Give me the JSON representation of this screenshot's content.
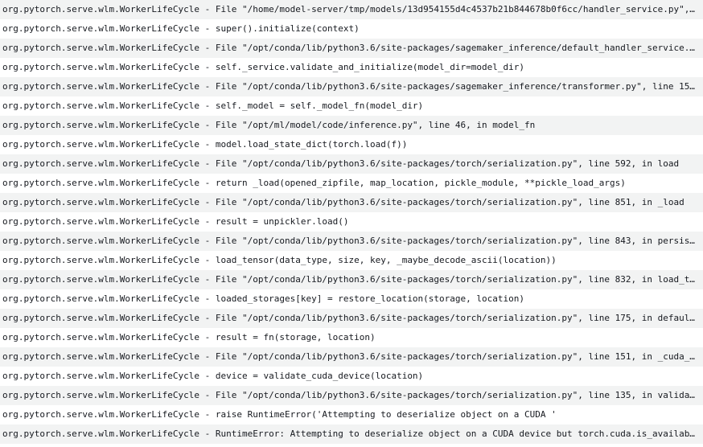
{
  "log": {
    "rows": [
      "org.pytorch.serve.wlm.WorkerLifeCycle - File \"/home/model-server/tmp/models/13d954155d4c4537b21b844678b0f6cc/handler_service.py\",…",
      "org.pytorch.serve.wlm.WorkerLifeCycle - super().initialize(context)",
      "org.pytorch.serve.wlm.WorkerLifeCycle - File \"/opt/conda/lib/python3.6/site-packages/sagemaker_inference/default_handler_service.…",
      "org.pytorch.serve.wlm.WorkerLifeCycle - self._service.validate_and_initialize(model_dir=model_dir)",
      "org.pytorch.serve.wlm.WorkerLifeCycle - File \"/opt/conda/lib/python3.6/site-packages/sagemaker_inference/transformer.py\", line 15…",
      "org.pytorch.serve.wlm.WorkerLifeCycle - self._model = self._model_fn(model_dir)",
      "org.pytorch.serve.wlm.WorkerLifeCycle - File \"/opt/ml/model/code/inference.py\", line 46, in model_fn",
      "org.pytorch.serve.wlm.WorkerLifeCycle - model.load_state_dict(torch.load(f))",
      "org.pytorch.serve.wlm.WorkerLifeCycle - File \"/opt/conda/lib/python3.6/site-packages/torch/serialization.py\", line 592, in load",
      "org.pytorch.serve.wlm.WorkerLifeCycle - return _load(opened_zipfile, map_location, pickle_module, **pickle_load_args)",
      "org.pytorch.serve.wlm.WorkerLifeCycle - File \"/opt/conda/lib/python3.6/site-packages/torch/serialization.py\", line 851, in _load",
      "org.pytorch.serve.wlm.WorkerLifeCycle - result = unpickler.load()",
      "org.pytorch.serve.wlm.WorkerLifeCycle - File \"/opt/conda/lib/python3.6/site-packages/torch/serialization.py\", line 843, in persis…",
      "org.pytorch.serve.wlm.WorkerLifeCycle - load_tensor(data_type, size, key, _maybe_decode_ascii(location))",
      "org.pytorch.serve.wlm.WorkerLifeCycle - File \"/opt/conda/lib/python3.6/site-packages/torch/serialization.py\", line 832, in load_t…",
      "org.pytorch.serve.wlm.WorkerLifeCycle - loaded_storages[key] = restore_location(storage, location)",
      "org.pytorch.serve.wlm.WorkerLifeCycle - File \"/opt/conda/lib/python3.6/site-packages/torch/serialization.py\", line 175, in defaul…",
      "org.pytorch.serve.wlm.WorkerLifeCycle - result = fn(storage, location)",
      "org.pytorch.serve.wlm.WorkerLifeCycle - File \"/opt/conda/lib/python3.6/site-packages/torch/serialization.py\", line 151, in _cuda_…",
      "org.pytorch.serve.wlm.WorkerLifeCycle - device = validate_cuda_device(location)",
      "org.pytorch.serve.wlm.WorkerLifeCycle - File \"/opt/conda/lib/python3.6/site-packages/torch/serialization.py\", line 135, in valida…",
      "org.pytorch.serve.wlm.WorkerLifeCycle - raise RuntimeError('Attempting to deserialize object on a CUDA '",
      "org.pytorch.serve.wlm.WorkerLifeCycle - RuntimeError: Attempting to deserialize object on a CUDA device but torch.cuda.is_availab…"
    ]
  }
}
